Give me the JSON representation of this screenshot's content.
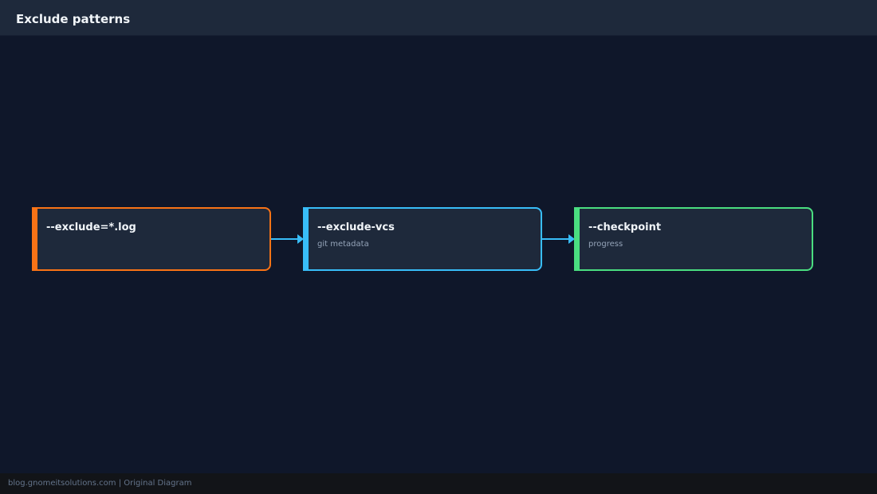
{
  "header": {
    "title": "Exclude patterns"
  },
  "nodes": [
    {
      "title": "--exclude=*.log",
      "subtitle": "",
      "color": "#f97316"
    },
    {
      "title": "--exclude-vcs",
      "subtitle": "git metadata",
      "color": "#38bdf8"
    },
    {
      "title": "--checkpoint",
      "subtitle": "progress",
      "color": "#4ade80"
    }
  ],
  "connector_color": "#38bdf8",
  "footer": {
    "text": "blog.gnomeitsolutions.com | Original Diagram"
  }
}
